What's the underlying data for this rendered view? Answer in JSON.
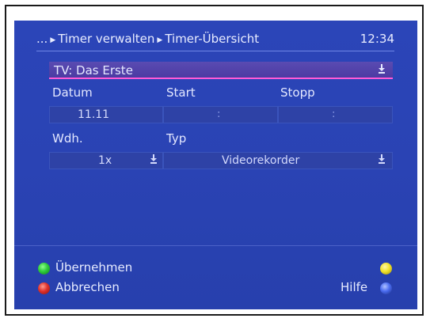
{
  "header": {
    "breadcrumb_prefix": "...",
    "breadcrumb_1": "Timer verwalten",
    "breadcrumb_2": "Timer-Übersicht",
    "clock": "12:34"
  },
  "channel": {
    "value": "TV: Das Erste"
  },
  "schedule": {
    "datum_label": "Datum",
    "start_label": "Start",
    "stopp_label": "Stopp",
    "datum_value": "11.11",
    "start_value": ":",
    "stopp_value": ":"
  },
  "repeat": {
    "wdh_label": "Wdh.",
    "typ_label": "Typ",
    "wdh_value": "1x",
    "typ_value": "Videorekorder"
  },
  "footer": {
    "accept_label": "Übernehmen",
    "cancel_label": "Abbrechen",
    "help_label": "Hilfe"
  },
  "colors": {
    "background": "#2a43b4",
    "highlight_underline": "#ff5ad8",
    "green_key": "#2ecc3a",
    "red_key": "#e0302a",
    "yellow_key": "#f2e22a",
    "blue_key": "#4a6cf0"
  },
  "icons": {
    "dropdown": "download-arrow-icon"
  }
}
